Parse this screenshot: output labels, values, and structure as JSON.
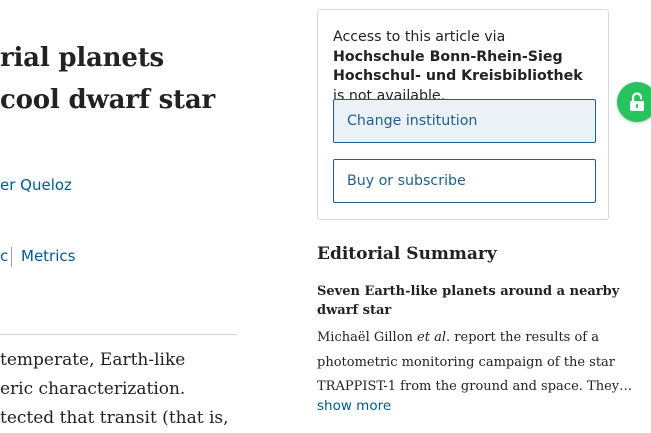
{
  "article": {
    "title_line1": "rial planets",
    "title_line2": "cool dwarf star",
    "author_partial": "er Queloz",
    "meta_cut": "c",
    "metrics_link": "Metrics",
    "abstract_lines": [
      "temperate, Earth-like",
      "eric characterization.",
      "tected that transit (that is,"
    ]
  },
  "access": {
    "text_prefix": "Access to this article via ",
    "institution": "Hochschule Bonn-Rhein-Sieg Hochschul- und Kreisbibliothek",
    "text_suffix": " is not available.",
    "change_institution_label": "Change institution",
    "buy_label": "Buy or subscribe"
  },
  "lock_tab": {
    "icon": "open-lock-icon",
    "color": "#28c35f"
  },
  "editorial_summary": {
    "heading": "Editorial Summary",
    "subheading_line1": "Seven Earth-like planets around a nearby",
    "subheading_line2": "dwarf star",
    "body_author": "Michaël Gillon ",
    "body_etal": "et al",
    "body_line1_rest": ". report the results of a",
    "body_line2": "photometric monitoring campaign of the star",
    "body_line3": "TRAPPIST-1 from the ground and space. They…",
    "show_more": "show more"
  },
  "colors": {
    "link": "#005a8c",
    "button_border": "#1f5f88",
    "button_active_bg": "#eaf2f8",
    "lock_green": "#28c35f"
  }
}
